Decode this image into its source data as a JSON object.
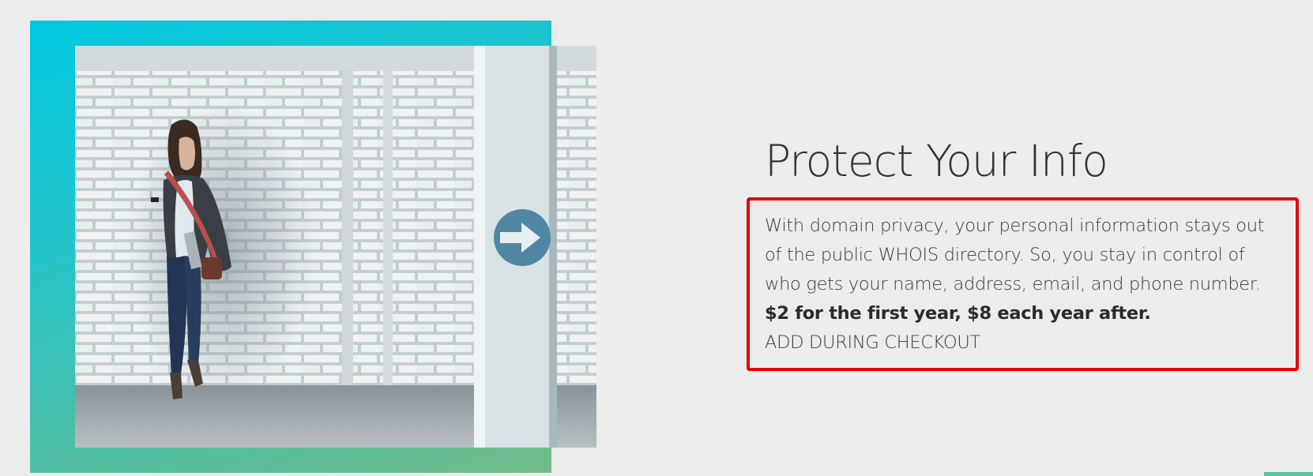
{
  "section": {
    "title": "Protect Your Info",
    "description_lines": [
      "With domain privacy, your personal information stays out",
      "of the public WHOIS directory. So, you stay in control of",
      "who gets your name, address, email, and phone number."
    ],
    "price": "$2 for the first year, $8 each year after.",
    "cta": "ADD DURING CHECKOUT"
  },
  "colors": {
    "gradient_start": "#00c8e0",
    "gradient_end": "#72bb88",
    "highlight_border": "#e60000",
    "sign_blue": "#4f86a3"
  },
  "icons": {
    "photo_sign": "arrow-right-icon"
  }
}
